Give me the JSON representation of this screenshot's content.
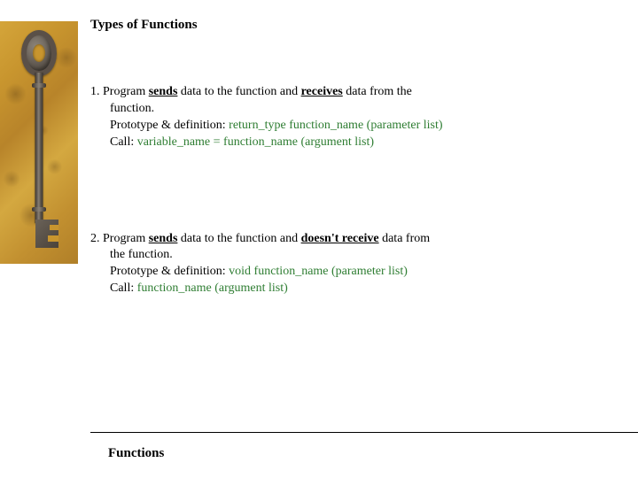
{
  "title": "Types of Functions",
  "item1": {
    "lead": "1. Program ",
    "sends": "sends",
    "mid1": " data to the function and ",
    "receives": "receives",
    "tail1": " data from the",
    "line2": "function.",
    "protoLabel": "Prototype & definition: ",
    "protoCode": "return_type function_name (parameter list)",
    "callLabel": "Call: ",
    "callCode": "variable_name = function_name (argument list)"
  },
  "item2": {
    "lead": "2. Program ",
    "sends": "sends",
    "mid1": " data to the function and ",
    "doesnt": "doesn't receive",
    "tail1": " data from",
    "line2": "the function.",
    "protoLabel": "Prototype & definition: ",
    "protoCode": "void function_name (parameter list)",
    "callLabel": "Call: ",
    "callCode": "function_name (argument list)"
  },
  "footer": "Functions"
}
